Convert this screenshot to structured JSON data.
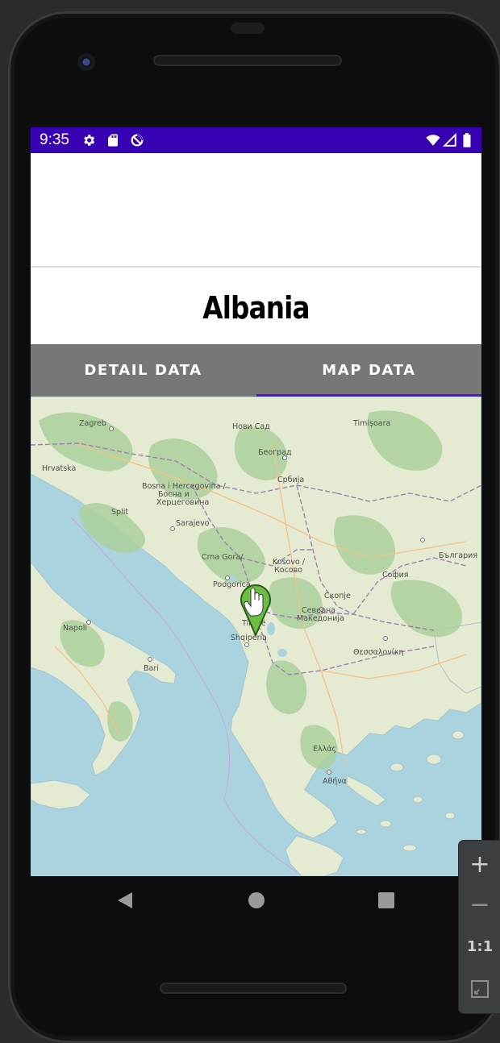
{
  "status_bar": {
    "time": "9:35",
    "icons": [
      "gear-icon",
      "sd-card-icon",
      "do-not-disturb-icon",
      "wifi-icon",
      "signal-icon",
      "battery-icon"
    ],
    "background_color": "#3700b3"
  },
  "country": {
    "name": "Albania"
  },
  "tabs": [
    {
      "label": "DETAIL DATA",
      "selected": false
    },
    {
      "label": "MAP DATA",
      "selected": true
    }
  ],
  "tab_colors": {
    "bar_background": "#777777",
    "indicator": "#5b10e0"
  },
  "map": {
    "tile_source_style": "OpenStreetMap",
    "marker": {
      "icon": "green-map-pin-with-hand-icon",
      "location_label": "Shqipëria"
    },
    "labels": {
      "hrvatska": "Hrvatska",
      "bosnia": "Bosna i Hercegovina /",
      "bosnia2": "Босна и",
      "bosnia3": "Херцеговина",
      "srbija": "Србија",
      "beograd": "Београд",
      "novi_sad": "Нови Сад",
      "crna_gora": "Crna Gora/",
      "kosovo": "Kosovo /",
      "kosovo2": "Косово",
      "shqiperia": "Shqipëria",
      "severna": "Северна",
      "makedonija": "Македонија",
      "bulgaria": "България",
      "sofia": "София",
      "ellada": "Ελλάς",
      "split": "Split",
      "napoli": "Napoli",
      "tirana": "Tiranë",
      "skopje": "Скопје",
      "sarajevo": "Sarajevo",
      "podgorica": "Podgorica",
      "bari": "Bari",
      "thessaloniki": "Θεσσαλονίκη",
      "athina": "Αθήνα",
      "zagreb": "Zagreb",
      "timisoara": "Timișoara"
    }
  },
  "nav_bar": {
    "buttons": [
      "back-triangle-icon",
      "home-circle-icon",
      "recents-square-icon"
    ]
  },
  "emulator_zoom": {
    "zoom_in": "+",
    "zoom_out": "−",
    "one_to_one": "1:1",
    "fit_icon": "fit-screen-icon"
  }
}
